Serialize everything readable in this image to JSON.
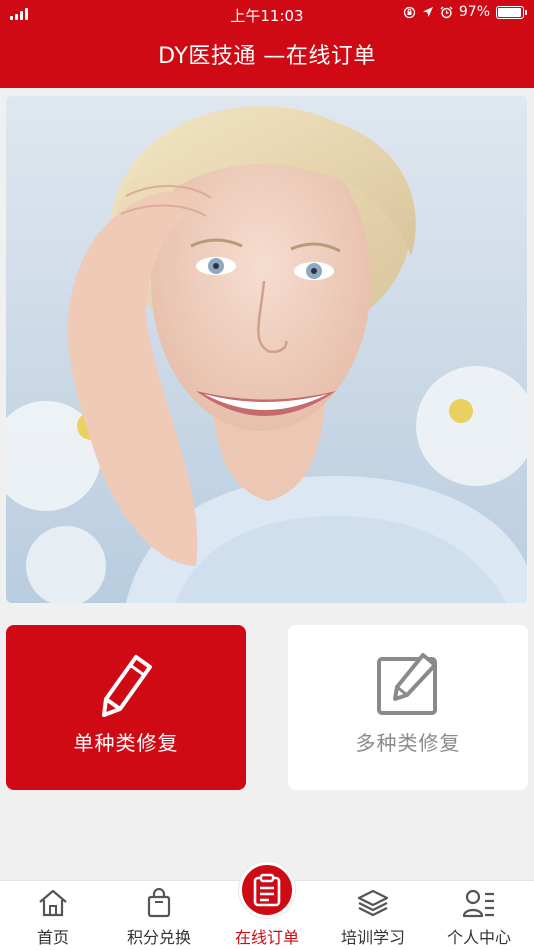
{
  "status_bar": {
    "time": "上午11:03",
    "battery": "97%",
    "battery_level": 0.97
  },
  "header": {
    "title": "DY医技通 —在线订单"
  },
  "cards": {
    "single": {
      "label": "单种类修复",
      "icon": "pencil-icon"
    },
    "multi": {
      "label": "多种类修复",
      "icon": "edit-square-icon"
    }
  },
  "tabbar": {
    "items": [
      {
        "label": "首页",
        "icon": "home-icon"
      },
      {
        "label": "积分兑换",
        "icon": "shopping-bag-icon"
      },
      {
        "label": "在线订单",
        "icon": "clipboard-icon"
      },
      {
        "label": "培训学习",
        "icon": "layers-icon"
      },
      {
        "label": "个人中心",
        "icon": "user-list-icon"
      }
    ],
    "active_index": 2
  },
  "colors": {
    "brand_red": "#cf0a14",
    "inactive_gray": "#8a8a8a",
    "background": "#f0f0f0"
  }
}
